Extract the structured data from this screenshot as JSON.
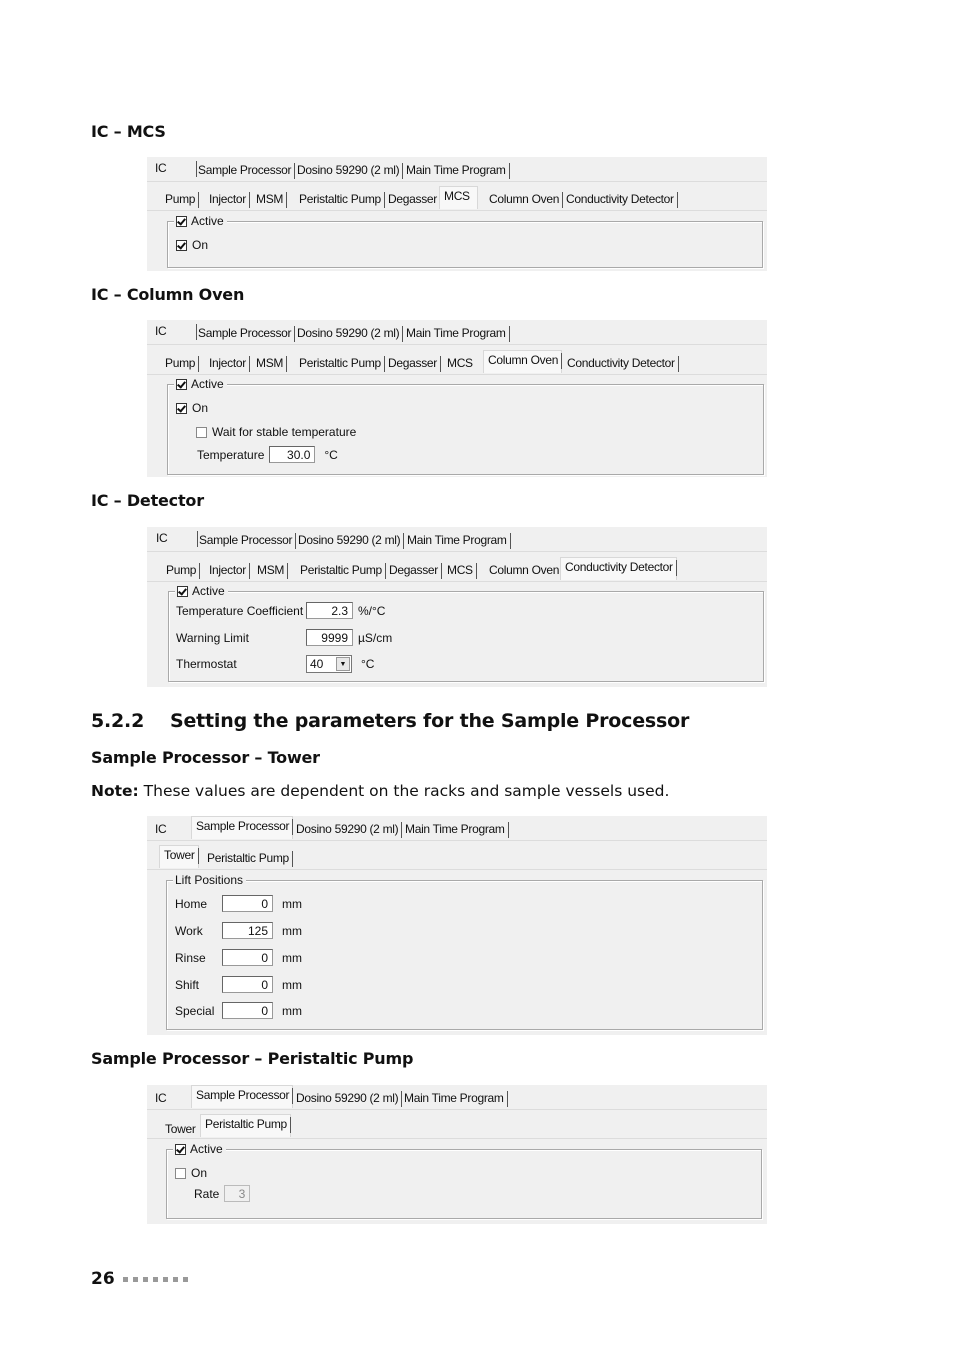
{
  "sections": {
    "mcs_heading": "IC – MCS",
    "column_oven_heading": "IC – Column Oven",
    "detector_heading": "IC – Detector",
    "chapter_number": "5.2.2",
    "chapter_title": "Setting the parameters for the Sample Processor",
    "tower_heading": "Sample Processor – Tower",
    "note_label": "Note:",
    "note_text": " These values are dependent on the racks and sample vessels used.",
    "peristaltic_heading": "Sample Processor – Peristaltic Pump"
  },
  "main_tabs": [
    "IC",
    "Sample Processor",
    "Dosino 59290 (2 ml)",
    "Main Time Program"
  ],
  "ic_subtabs": [
    "Pump",
    "Injector",
    "MSM",
    "Peristaltic Pump",
    "Degasser",
    "MCS",
    "Column Oven",
    "Conductivity Detector"
  ],
  "sp_subtabs": [
    "Tower",
    "Peristaltic Pump"
  ],
  "mcs": {
    "active_label": "Active",
    "active_checked": true,
    "on_label": "On",
    "on_checked": true
  },
  "column_oven": {
    "active_label": "Active",
    "active_checked": true,
    "on_label": "On",
    "on_checked": true,
    "wait_label": "Wait for stable temperature",
    "wait_checked": false,
    "temperature_label": "Temperature",
    "temperature_value": "30.0",
    "temperature_unit": "°C"
  },
  "detector": {
    "active_label": "Active",
    "active_checked": true,
    "temp_coef_label": "Temperature Coefficient",
    "temp_coef_value": "2.3",
    "temp_coef_unit": "%/°C",
    "warning_label": "Warning Limit",
    "warning_value": "9999",
    "warning_unit": "µS/cm",
    "thermostat_label": "Thermostat",
    "thermostat_value": "40",
    "thermostat_unit": "°C"
  },
  "tower": {
    "group_title": "Lift Positions",
    "rows": [
      {
        "label": "Home",
        "value": "0",
        "unit": "mm"
      },
      {
        "label": "Work",
        "value": "125",
        "unit": "mm"
      },
      {
        "label": "Rinse",
        "value": "0",
        "unit": "mm"
      },
      {
        "label": "Shift",
        "value": "0",
        "unit": "mm"
      },
      {
        "label": "Special",
        "value": "0",
        "unit": "mm"
      }
    ]
  },
  "sp_peristaltic": {
    "active_label": "Active",
    "active_checked": true,
    "on_label": "On",
    "on_checked": false,
    "rate_label": "Rate",
    "rate_value": "3"
  },
  "footer": {
    "page_number": "26"
  }
}
